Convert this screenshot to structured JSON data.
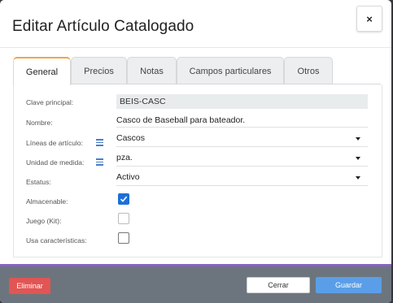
{
  "dialog": {
    "title": "Editar Artículo Catalogado",
    "close_label": "×"
  },
  "tabs": [
    {
      "label": "General",
      "active": true
    },
    {
      "label": "Precios",
      "active": false
    },
    {
      "label": "Notas",
      "active": false
    },
    {
      "label": "Campos particulares",
      "active": false
    },
    {
      "label": "Otros",
      "active": false
    }
  ],
  "form": {
    "clave_label": "Clave principal:",
    "clave_value": "BEIS-CASC",
    "nombre_label": "Nombre:",
    "nombre_value": "Casco de Baseball para bateador.",
    "lineas_label": "Líneas de artículo:",
    "lineas_value": "Cascos",
    "unidad_label": "Unidad de medida:",
    "unidad_value": "pza.",
    "estatus_label": "Estatus:",
    "estatus_value": "Activo",
    "almacenable_label": "Almacenable:",
    "almacenable_checked": true,
    "juego_label": "Juego (Kit):",
    "juego_checked": false,
    "caracteristicas_label": "Usa características:",
    "caracteristicas_checked": false
  },
  "footer": {
    "delete_label": "Eliminar",
    "cancel_label": "Cerrar",
    "save_label": "Guardar"
  },
  "colors": {
    "active_tab_accent": "#f0a44a",
    "primary": "#5b9ee8",
    "danger": "#e15554",
    "checkbox_checked": "#1d6fd6",
    "footer_bg": "#6c757d",
    "separator": "#8a62c4"
  }
}
